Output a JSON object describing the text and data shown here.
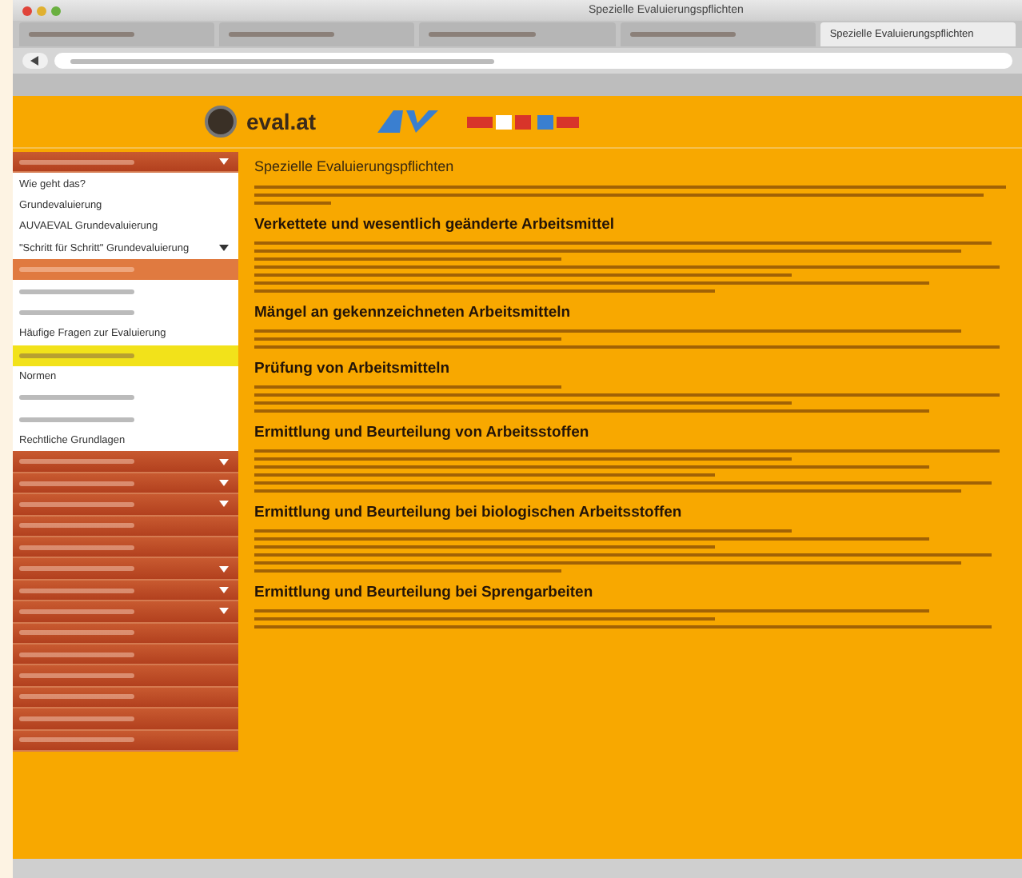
{
  "window": {
    "title": "Spezielle Evaluierungspflichten"
  },
  "tabs": [
    {
      "selected": false
    },
    {
      "selected": false
    },
    {
      "selected": false
    },
    {
      "selected": false
    },
    {
      "label": "Spezielle Evaluierungspflichten",
      "selected": true
    }
  ],
  "logo": "eval.at",
  "sidebar": {
    "items": [
      {
        "kind": "header",
        "submenu": true
      },
      {
        "kind": "link",
        "label": "Wie geht das?"
      },
      {
        "kind": "link",
        "label": "Grundevaluierung"
      },
      {
        "kind": "link",
        "label": "AUVAEVAL Grundevaluierung"
      },
      {
        "kind": "link",
        "label": "\"Schritt für Schritt\" Grundevaluierung",
        "submenu": true
      },
      {
        "kind": "group"
      },
      {
        "kind": "link"
      },
      {
        "kind": "link"
      },
      {
        "kind": "link",
        "label": "Häufige Fragen zur Evaluierung"
      },
      {
        "kind": "current"
      },
      {
        "kind": "link",
        "label": "Normen"
      },
      {
        "kind": "link"
      },
      {
        "kind": "link"
      },
      {
        "kind": "link",
        "label": "Rechtliche Grundlagen"
      },
      {
        "kind": "header",
        "submenu": true
      },
      {
        "kind": "header",
        "submenu": true
      },
      {
        "kind": "header",
        "submenu": true
      },
      {
        "kind": "header"
      },
      {
        "kind": "header"
      },
      {
        "kind": "header",
        "submenu": true
      },
      {
        "kind": "header",
        "submenu": true
      },
      {
        "kind": "header",
        "submenu": true
      },
      {
        "kind": "header"
      },
      {
        "kind": "header"
      },
      {
        "kind": "header"
      },
      {
        "kind": "header"
      },
      {
        "kind": "header"
      },
      {
        "kind": "header"
      }
    ]
  },
  "article": {
    "title": "Spezielle Evaluierungspflichten",
    "sections": [
      {
        "heading": "Verkettete und wesentlich geänderte Arbeitsmittel"
      },
      {
        "heading": "Mängel an gekennzeichneten Arbeitsmitteln"
      },
      {
        "heading": "Prüfung von Arbeitsmitteln"
      },
      {
        "heading": "Ermittlung und Beurteilung von Arbeitsstoffen"
      },
      {
        "heading": "Ermittlung und Beurteilung bei biologischen Arbeitsstoffen"
      },
      {
        "heading": "Ermittlung und Beurteilung bei Sprengarbeiten"
      }
    ]
  }
}
